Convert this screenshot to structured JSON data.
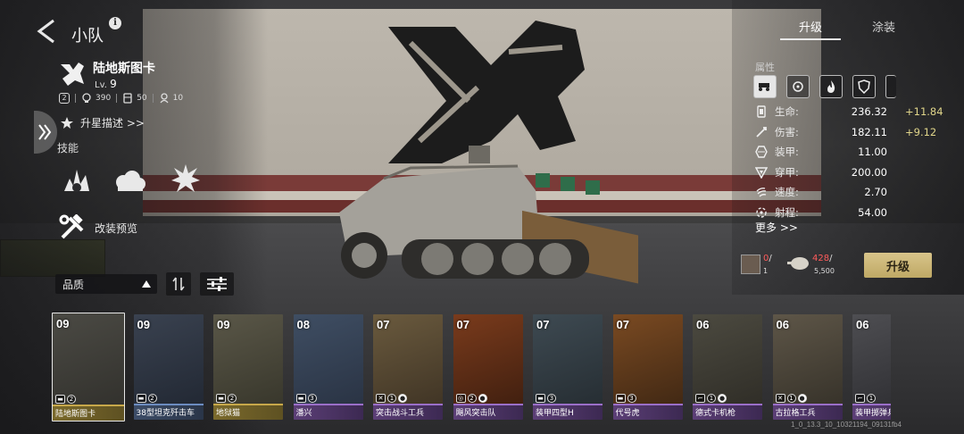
{
  "header": {
    "title": "小队"
  },
  "unit": {
    "name": "陆地斯图卡",
    "level_prefix": "Lv.",
    "level": "9",
    "slot_badge": "2",
    "stat1": "390",
    "stat2": "50",
    "stat3": "10",
    "star_upgrade_label": "升星描述 >>",
    "skills_title": "技能",
    "mod_preview_label": "改装预览"
  },
  "filters": {
    "quality_label": "品质"
  },
  "tabs": {
    "upgrade": "升级",
    "paint": "涂装"
  },
  "attributes": {
    "title": "属性",
    "icons": [
      "vehicle-icon",
      "crosshair-icon",
      "fire-icon",
      "shield-icon"
    ],
    "stats": [
      {
        "label": "生命:",
        "value": "236.32",
        "bonus": "+11.84",
        "icon": "health-icon"
      },
      {
        "label": "伤害:",
        "value": "182.11",
        "bonus": "+9.12",
        "icon": "damage-icon"
      },
      {
        "label": "装甲:",
        "value": "11.00",
        "bonus": "",
        "icon": "armor-icon"
      },
      {
        "label": "穿甲:",
        "value": "200.00",
        "bonus": "",
        "icon": "penetration-icon"
      },
      {
        "label": "速度:",
        "value": "2.70",
        "bonus": "",
        "icon": "speed-icon"
      },
      {
        "label": "射程:",
        "value": "54.00",
        "bonus": "",
        "icon": "range-icon"
      }
    ],
    "more_label": "更多 >>"
  },
  "upgrade": {
    "item1_have": "0",
    "item1_slash": "/",
    "item1_need": "1",
    "item2_have": "428",
    "item2_slash": "/",
    "item2_need": "5,500",
    "button_label": "升级"
  },
  "cards": [
    {
      "level": "09",
      "name": "陆地斯图卡",
      "bar": "gold",
      "badges": [
        "tank",
        "2"
      ],
      "selected": true
    },
    {
      "level": "09",
      "name": "38型坦克歼击车",
      "bar": "blue",
      "badges": [
        "tank",
        "2"
      ]
    },
    {
      "level": "09",
      "name": "地狱猫",
      "bar": "gold",
      "badges": [
        "tank",
        "2"
      ]
    },
    {
      "level": "08",
      "name": "潘兴",
      "bar": "purple",
      "badges": [
        "tank",
        "3"
      ]
    },
    {
      "level": "07",
      "name": "突击战斗工兵",
      "bar": "purple",
      "badges": [
        "tool",
        "1",
        "chat"
      ]
    },
    {
      "level": "07",
      "name": "飓风突击队",
      "bar": "purple",
      "badges": [
        "mask",
        "2",
        "chat"
      ]
    },
    {
      "level": "07",
      "name": "装甲四型H",
      "bar": "purple",
      "badges": [
        "tank",
        "3"
      ]
    },
    {
      "level": "07",
      "name": "代号虎",
      "bar": "purple",
      "badges": [
        "tank",
        "3"
      ]
    },
    {
      "level": "06",
      "name": "德式卡机枪",
      "bar": "purple",
      "badges": [
        "gun",
        "1",
        "chat"
      ]
    },
    {
      "level": "06",
      "name": "古拉格工兵",
      "bar": "purple",
      "badges": [
        "tool",
        "1",
        "chat"
      ]
    },
    {
      "level": "06",
      "name": "装甲掷弹兵",
      "bar": "purple",
      "badges": [
        "gun",
        "1"
      ]
    }
  ],
  "version": "1_0_13.3_10_10321194_09131fb4",
  "colors": {
    "gold": "#c7a84a",
    "purple": "#9b6fc9",
    "blue": "#6c8cc0",
    "bonus": "#e0d58a",
    "insufficient": "#ff5b5b"
  }
}
